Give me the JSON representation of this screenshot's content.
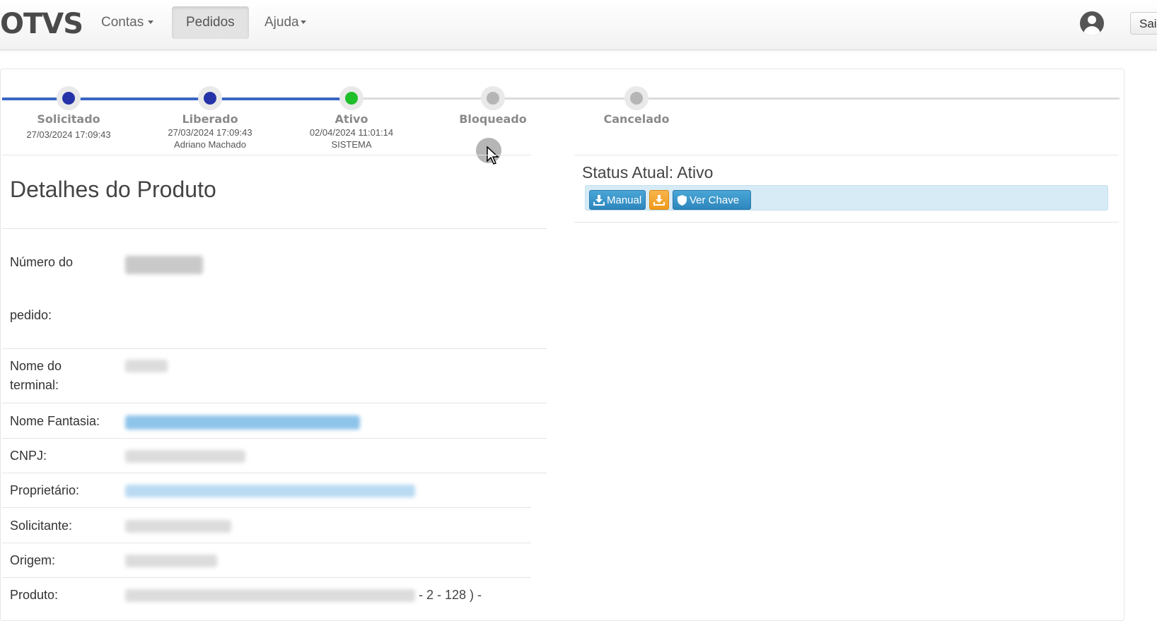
{
  "navbar": {
    "brand": "OTVS",
    "items": [
      {
        "label": "Contas",
        "has_caret": true
      },
      {
        "label": "Pedidos",
        "active": true
      },
      {
        "label": "Ajuda",
        "has_caret": true
      }
    ],
    "logout_label": "Sai"
  },
  "tracker": {
    "steps": [
      {
        "label": "Solicitado",
        "line1": "27/03/2024 17:09:43",
        "line2": "",
        "state": "done",
        "color": "#2633a8"
      },
      {
        "label": "Liberado",
        "line1": "27/03/2024 17:09:43",
        "line2": "Adriano Machado",
        "state": "done",
        "color": "#2633a8"
      },
      {
        "label": "Ativo",
        "line1": "02/04/2024 11:01:14",
        "line2": "SISTEMA",
        "state": "current",
        "color": "#1fbf2a"
      },
      {
        "label": "Bloqueado",
        "line1": "",
        "line2": "",
        "state": "pending",
        "color": "#b5b5b5"
      },
      {
        "label": "Cancelado",
        "line1": "",
        "line2": "",
        "state": "pending",
        "color": "#b5b5b5"
      }
    ]
  },
  "details": {
    "title": "Detalhes do Produto",
    "fields": {
      "numero_label_1": "Número do",
      "numero_label_2": "pedido:",
      "terminal_label_1": "Nome do",
      "terminal_label_2": "terminal:",
      "fantasia_label": "Nome Fantasia:",
      "cnpj_label": "CNPJ:",
      "proprietario_label": "Proprietário:",
      "solicitante_label": "Solicitante:",
      "origem_label": "Origem:",
      "produto_label": "Produto:",
      "produto_value_tail": "- 2 - 128 ) -"
    }
  },
  "status": {
    "title": "Status Atual: Ativo",
    "manual_label": "Manual",
    "ver_chave_label": "Ver Chave"
  },
  "colors": {
    "track_done": "#3a66c4",
    "track_pending": "#d9d9d9",
    "button_blue": "#2d86bd",
    "button_orange": "#ef9b1c",
    "status_bg": "#d7ebf6"
  }
}
